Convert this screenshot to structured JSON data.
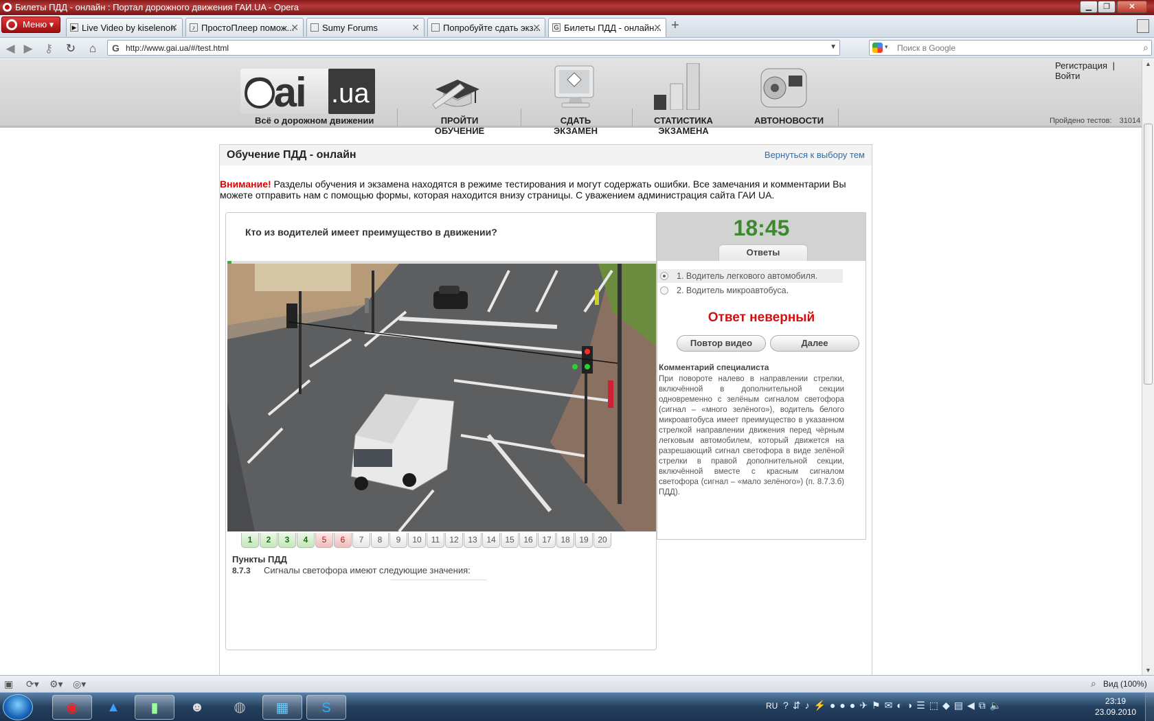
{
  "window": {
    "title": "Билеты ПДД - онлайн : Портал дорожного движения ГАИ.UA - Opera",
    "min": "▁",
    "max": "❐",
    "close": "✕"
  },
  "browser": {
    "menu_label": "Меню",
    "tabs": [
      {
        "label": "Live Video by kiselenon",
        "active": false
      },
      {
        "label": "ПростоПлеер помож...",
        "active": false
      },
      {
        "label": "Sumy Forums",
        "active": false
      },
      {
        "label": "Попробуйте сдать экз...",
        "active": false
      },
      {
        "label": "Билеты ПДД - онлайн...",
        "active": true
      }
    ],
    "new_tab": "+",
    "close_glyph": "✕",
    "url": "http://www.gai.ua/#/test.html",
    "search_placeholder": "Поиск в Google",
    "zoom_label": "Вид (100%)"
  },
  "site": {
    "logo_main": "Gai",
    "logo_ext": ".ua",
    "slogan": "Всё о дорожном движении",
    "nav": [
      "ПРОЙТИ ОБУЧЕНИЕ",
      "СДАТЬ ЭКЗАМЕН",
      "СТАТИСТИКА ЭКЗАМЕНА",
      "АВТОНОВОСТИ"
    ],
    "register": "Регистрация",
    "login": "Войти",
    "link_sep": "|",
    "tests_passed_label": "Пройдено тестов:",
    "tests_passed_value": "31014"
  },
  "main": {
    "title": "Обучение ПДД - онлайн",
    "back_link": "Вернуться к выбору тем",
    "warning_label": "Внимание!",
    "warning_text": " Разделы обучения и экзамена находятся в режиме тестирования и могут содержать ошибки. Все замечания и комментарии Вы можете отправить нам с помощью формы, которая находится внизу страницы. С уважением администрация сайта ГАИ UA."
  },
  "quiz": {
    "question": "Кто из водителей имеет преимущество в движении?",
    "timer": "18:45",
    "answers_tab": "Ответы",
    "answers": [
      {
        "label": "1. Водитель легкового автомобиля.",
        "selected": true
      },
      {
        "label": "2. Водитель микроавтобуса.",
        "selected": false
      }
    ],
    "verdict": "Ответ неверный",
    "replay_button": "Повтор видео",
    "next_button": "Далее",
    "comment_title": "Комментарий специалиста",
    "comment": "При повороте налево в направлении стрелки, включённой в дополнительной секции одновременно с зелёным сигналом светофора (сигнал – «много зелёного»), водитель белого микроавтобуса имеет преимущество в указанном стрелкой направлении движения перед чёрным легковым автомобилем, который движется на разрешающий сигнал светофора в виде зелёной стрелки в правой дополнительной секции, включённой вместе с красным сигналом светофора (сигнал – «мало зелёного») (п. 8.7.3.б) ПДД).",
    "numbers": [
      {
        "n": "1",
        "state": "correct"
      },
      {
        "n": "2",
        "state": "correct"
      },
      {
        "n": "3",
        "state": "correct"
      },
      {
        "n": "4",
        "state": "correct"
      },
      {
        "n": "5",
        "state": "wrong"
      },
      {
        "n": "6",
        "state": "wrong"
      },
      {
        "n": "7",
        "state": "none"
      },
      {
        "n": "8",
        "state": "none"
      },
      {
        "n": "9",
        "state": "none"
      },
      {
        "n": "10",
        "state": "none"
      },
      {
        "n": "11",
        "state": "none"
      },
      {
        "n": "12",
        "state": "none"
      },
      {
        "n": "13",
        "state": "none"
      },
      {
        "n": "14",
        "state": "none"
      },
      {
        "n": "15",
        "state": "none"
      },
      {
        "n": "16",
        "state": "none"
      },
      {
        "n": "17",
        "state": "none"
      },
      {
        "n": "18",
        "state": "none"
      },
      {
        "n": "19",
        "state": "none"
      },
      {
        "n": "20",
        "state": "none"
      }
    ],
    "rules_title": "Пункты ПДД",
    "rule_number": "8.7.3",
    "rule_text": "Сигналы светофора имеют следующие значения:"
  },
  "taskbar": {
    "lang": "RU",
    "time": "23:19",
    "date": "23.09.2010"
  },
  "colors": {
    "timer": "#3b8a2b",
    "verdict": "#d01010",
    "warning": "#dd0000",
    "link": "#2a6db5"
  }
}
